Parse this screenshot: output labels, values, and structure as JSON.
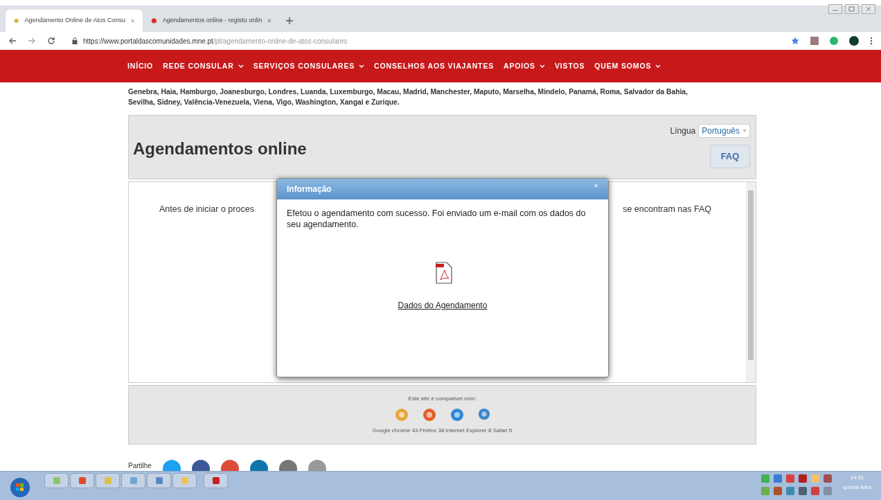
{
  "browser": {
    "tabs": [
      {
        "title": "Agendamento Online de Atos Consu",
        "selected": true
      },
      {
        "title": "Agendamentos online - registo onlin",
        "selected": false
      }
    ],
    "url_host": "https://www.portaldascomunidades.mne.pt",
    "url_path": "/pt/agendamento-online-de-atos-consulares"
  },
  "nav": [
    {
      "label": "INÍCIO",
      "dropdown": false
    },
    {
      "label": "REDE CONSULAR",
      "dropdown": true
    },
    {
      "label": "SERVIÇOS CONSULARES",
      "dropdown": true
    },
    {
      "label": "CONSELHOS AOS VIAJANTES",
      "dropdown": false
    },
    {
      "label": "APOIOS",
      "dropdown": true
    },
    {
      "label": "VISTOS",
      "dropdown": false
    },
    {
      "label": "QUEM SOMOS",
      "dropdown": true
    }
  ],
  "intro_lines": [
    "Genebra, Haia, Hamburgo, Joanesburgo, Londres, Luanda, Luxemburgo, Macau, Madrid, Manchester, Maputo, Marselha, Mindelo, Panamá, Roma, Salvador da Bahia,",
    "Sevilha, Sidney, Valência-Venezuela, Viena, Vigo, Washington, Xangai e Zurique."
  ],
  "app": {
    "title": "Agendamentos online",
    "language_label": "Língua",
    "language_value": "Português",
    "faq_button": "FAQ",
    "body_left": "Antes de iniciar o proces",
    "body_right": "se encontram nas FAQ"
  },
  "footer": {
    "compat_text": "Este site é compatível com:",
    "browsers_text": "Google chrome 43 Firefox 38 Internet Explorer 8 Safari 5"
  },
  "share_label": "Partilhe",
  "dialog": {
    "title": "Informação",
    "close": "×",
    "message": "Efetou o agendamento com sucesso. Foi enviado um e-mail com os dados do seu agendamento.",
    "link": "Dados do Agendamento"
  },
  "taskbar": {
    "time": "14:51",
    "day": "quarta-feira"
  }
}
